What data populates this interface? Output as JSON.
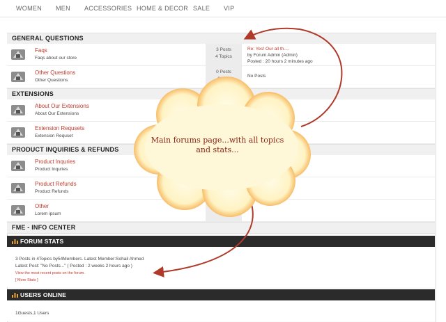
{
  "nav": {
    "items": [
      "WOMEN",
      "MEN",
      "ACCESSORIES",
      "HOME & DECOR",
      "SALE",
      "VIP"
    ]
  },
  "sections": {
    "general": "GENERAL QUESTIONS",
    "extensions": "EXTENSIONS",
    "product": "PRODUCT INQUIRIES & REFUNDS",
    "fme": "FME - INFO CENTER"
  },
  "forums": {
    "faqs": {
      "title": "Faqs",
      "desc": "Faqs about our store",
      "posts": "3 Posts",
      "topics": "4 Topics",
      "last_title": "Re: Yes! Our all th....",
      "last_by": "by Forum Admin (Admin)",
      "last_time": "Posted : 20 hours 2 minutes ago"
    },
    "other_questions": {
      "title": "Other Questions",
      "desc": "Other Questions",
      "posts": "0 Posts",
      "topics": "0 To...",
      "last": "No Posts"
    },
    "about_ext": {
      "title": "About Our Extensions",
      "desc": "About Our Extensions"
    },
    "ext_request": {
      "title": "Extension Requsets",
      "desc": "Extension Requset"
    },
    "product_inq": {
      "title": "Product Inquries",
      "desc": "Product Inquries"
    },
    "product_ref": {
      "title": "Product Refunds",
      "desc": "Product Refunds"
    },
    "other": {
      "title": "Other",
      "desc": "Lorem ipsum",
      "topics": "0 Topics"
    }
  },
  "forum_stats": {
    "title": "FORUM STATS",
    "line1": "3 Posts in 4Topics by54Members. Latest Member:Sohail Ahmed",
    "line2": "Latest Post: \"No Posts...\" ( Posted : 2 weeks 2 hours ago )",
    "recent_link": "View the most recent posts on the forum.",
    "more_link": "[ More Stats ]"
  },
  "users_online": {
    "title": "USERS ONLINE",
    "text": "1Guests,1 Users"
  },
  "callout": {
    "line1": "Main forums page...with all topics",
    "line2": "and stats..."
  },
  "colors": {
    "accent": "#c0392b",
    "dark_header": "#2b2b2b",
    "cloud_fill": "#fff6cc",
    "arrow": "#b03a2a"
  }
}
